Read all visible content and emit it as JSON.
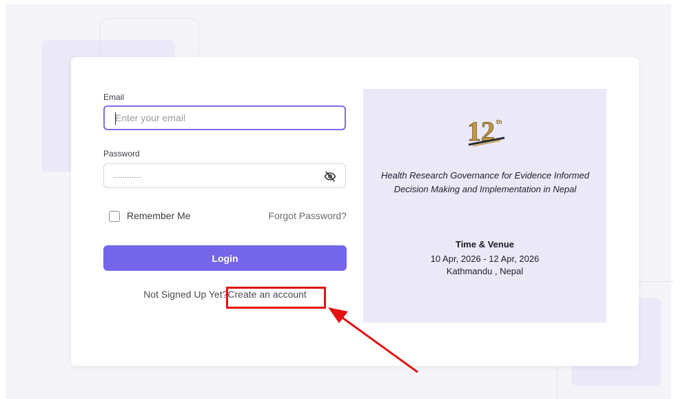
{
  "form": {
    "email_label": "Email",
    "email_placeholder": "Enter your email",
    "email_value": "",
    "password_label": "Password",
    "password_value": "............",
    "remember_label": "Remember Me",
    "forgot_label": "Forgot Password?",
    "login_label": "Login",
    "signup_prompt": "Not Signed Up Yet?",
    "signup_link": "Create an account"
  },
  "event": {
    "logo_number": "12",
    "logo_superscript": "th",
    "theme": "Health Research Governance for Evidence Informed Decision Making and Implementation in Nepal",
    "venue_title": "Time & Venue",
    "dates": "10 Apr, 2026 - 12 Apr, 2026",
    "location": "Kathmandu , Nepal"
  },
  "icons": {
    "password_toggle": "eye-off-icon"
  },
  "colors": {
    "accent": "#7566e9",
    "focus_border": "#7b6ee8",
    "panel_bg": "#ebe9f8",
    "annotation_red": "#e31212",
    "logo_gold": "#c59a3c"
  }
}
